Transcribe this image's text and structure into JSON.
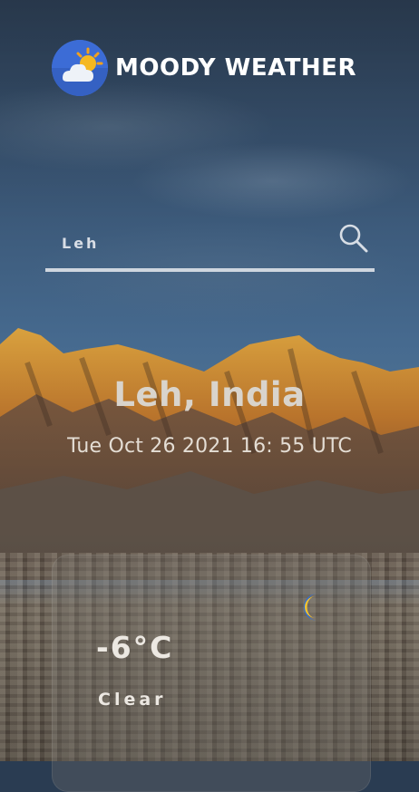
{
  "app": {
    "title": "MOODY WEATHER"
  },
  "search": {
    "value": "Leh",
    "placeholder": "Leh"
  },
  "location": {
    "name": "Leh, India",
    "datetime": "Tue Oct 26 2021 16: 55 UTC"
  },
  "weather": {
    "temperature": "-6°C",
    "condition": "Clear",
    "icon": "moon-icon"
  },
  "colors": {
    "logo_bg": "#3c6cd6",
    "moon": "#2f6fd8",
    "underline": "#cfd6df"
  }
}
